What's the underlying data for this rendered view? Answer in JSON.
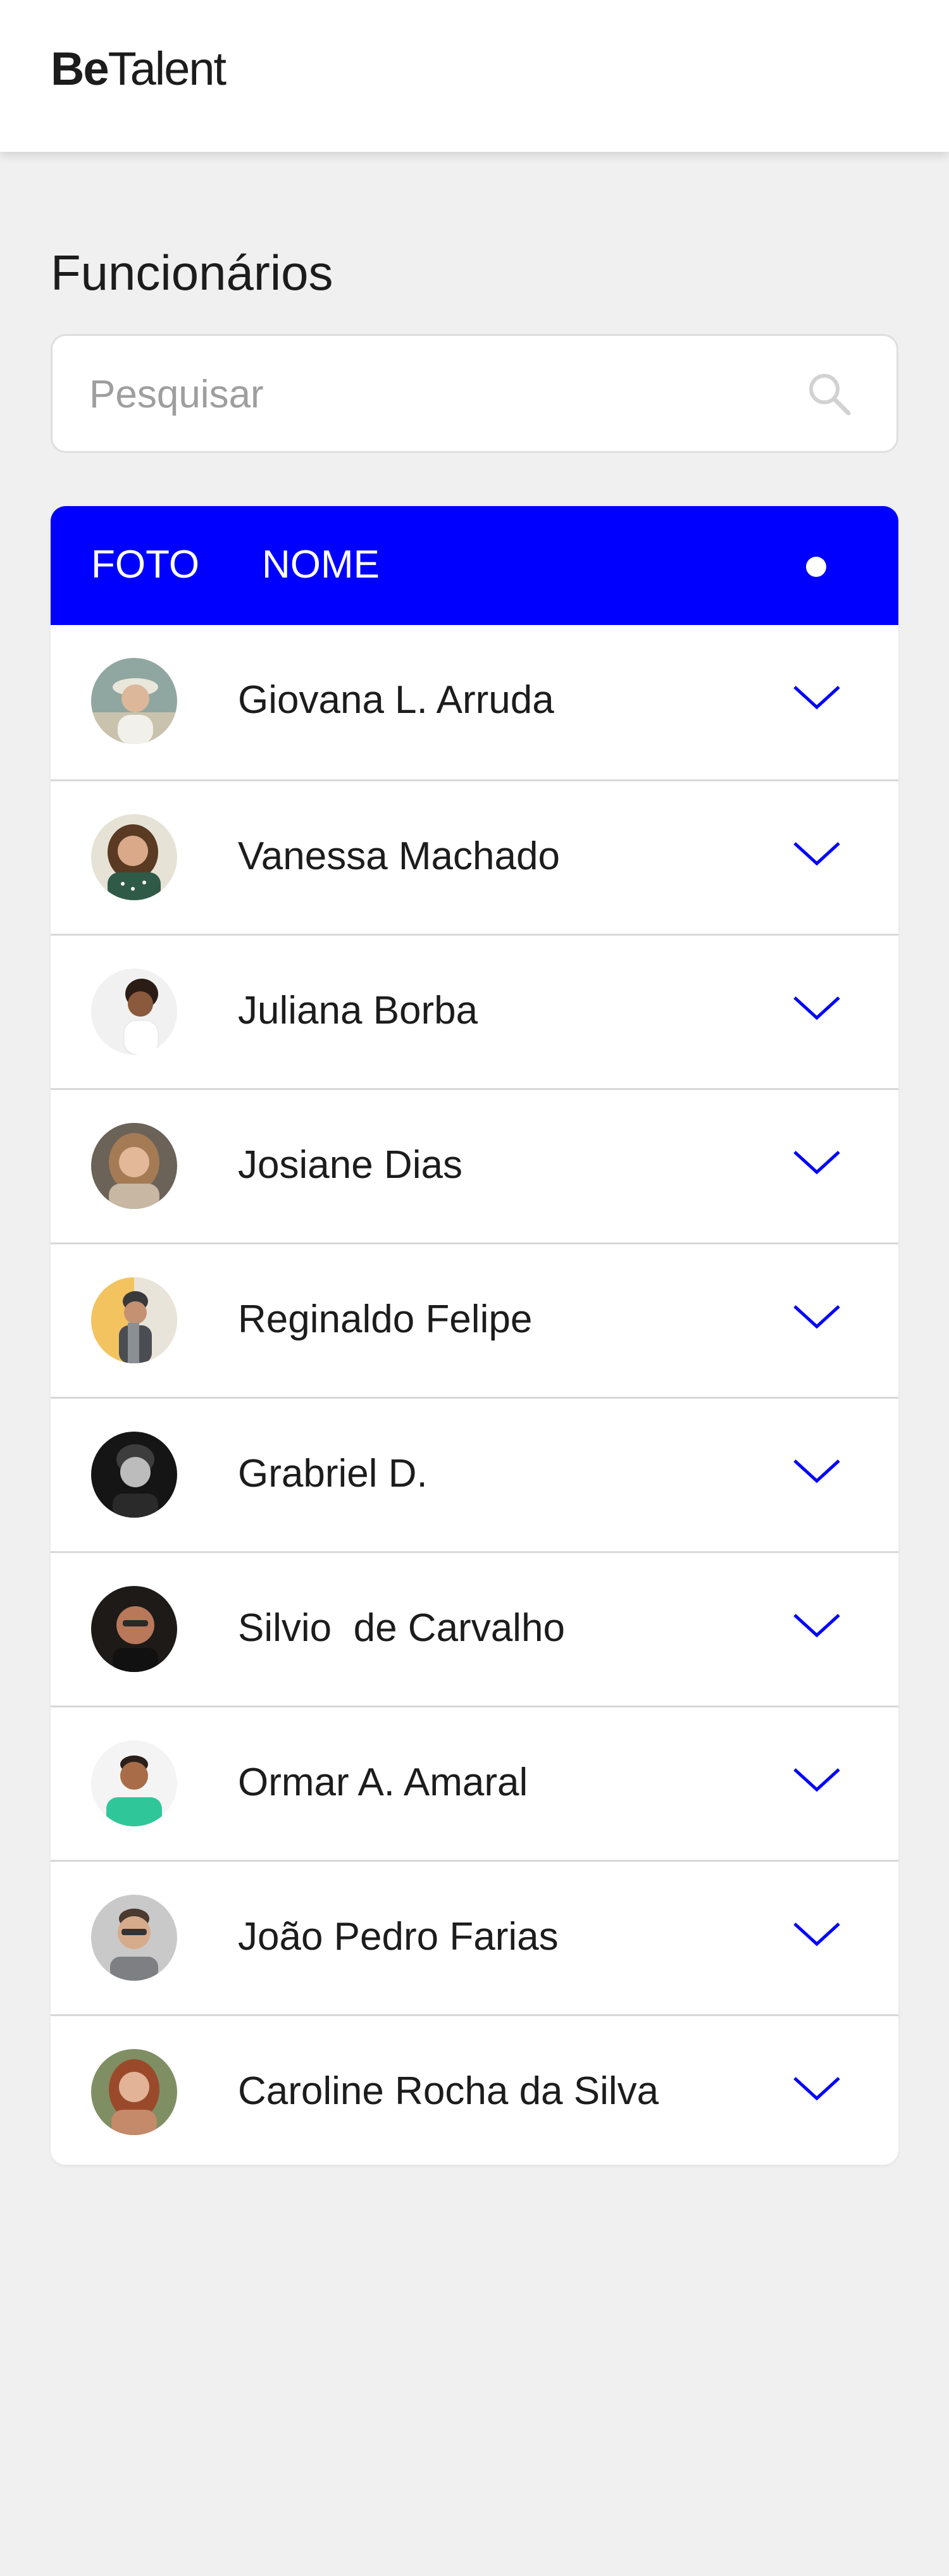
{
  "header": {
    "logo_bold": "Be",
    "logo_light": "Talent"
  },
  "page": {
    "title": "Funcionários"
  },
  "search": {
    "placeholder": "Pesquisar",
    "value": "",
    "icon": "search-icon"
  },
  "table": {
    "columns": {
      "photo": "FOTO",
      "name": "NOME"
    },
    "header_indicator_icon": "dot-icon",
    "row_toggle_icon": "chevron-down-icon",
    "rows": [
      {
        "name": "Giovana L. Arruda"
      },
      {
        "name": "Vanessa Machado"
      },
      {
        "name": "Juliana Borba"
      },
      {
        "name": "Josiane Dias"
      },
      {
        "name": "Reginaldo Felipe"
      },
      {
        "name": "Grabriel D."
      },
      {
        "name": "Silvio  de Carvalho"
      },
      {
        "name": "Ormar A. Amaral"
      },
      {
        "name": "João Pedro Farias"
      },
      {
        "name": "Caroline Rocha da Silva"
      }
    ]
  },
  "colors": {
    "accent": "#0000FF",
    "background": "#F0F0F0",
    "surface": "#FFFFFF",
    "text": "#1C1C1C",
    "placeholder": "#9E9E9E",
    "divider": "#D8D8D8"
  }
}
